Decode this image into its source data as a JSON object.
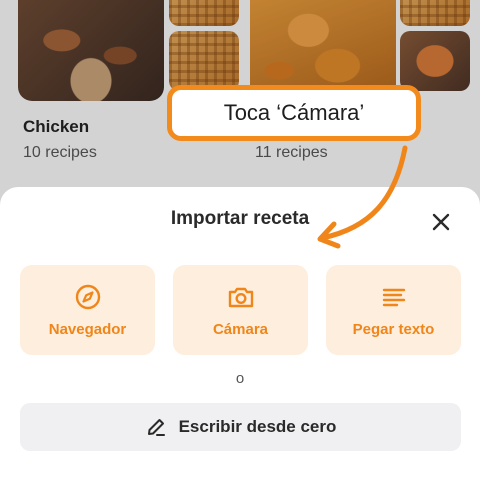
{
  "collections": [
    {
      "title": "Chicken",
      "count": "10 recipes"
    },
    {
      "title": "",
      "count": "11 recipes"
    }
  ],
  "callout": {
    "text": "Toca ‘Cámara’"
  },
  "sheet": {
    "title": "Importar receta",
    "options": [
      {
        "label": "Navegador",
        "icon": "compass-icon"
      },
      {
        "label": "Cámara",
        "icon": "camera-icon"
      },
      {
        "label": "Pegar texto",
        "icon": "text-lines-icon"
      }
    ],
    "or_text": "o",
    "scratch_label": "Escribir desde cero"
  },
  "colors": {
    "accent": "#f0861a",
    "option_bg": "#fdeedd",
    "scratch_bg": "#f0f0f2"
  }
}
